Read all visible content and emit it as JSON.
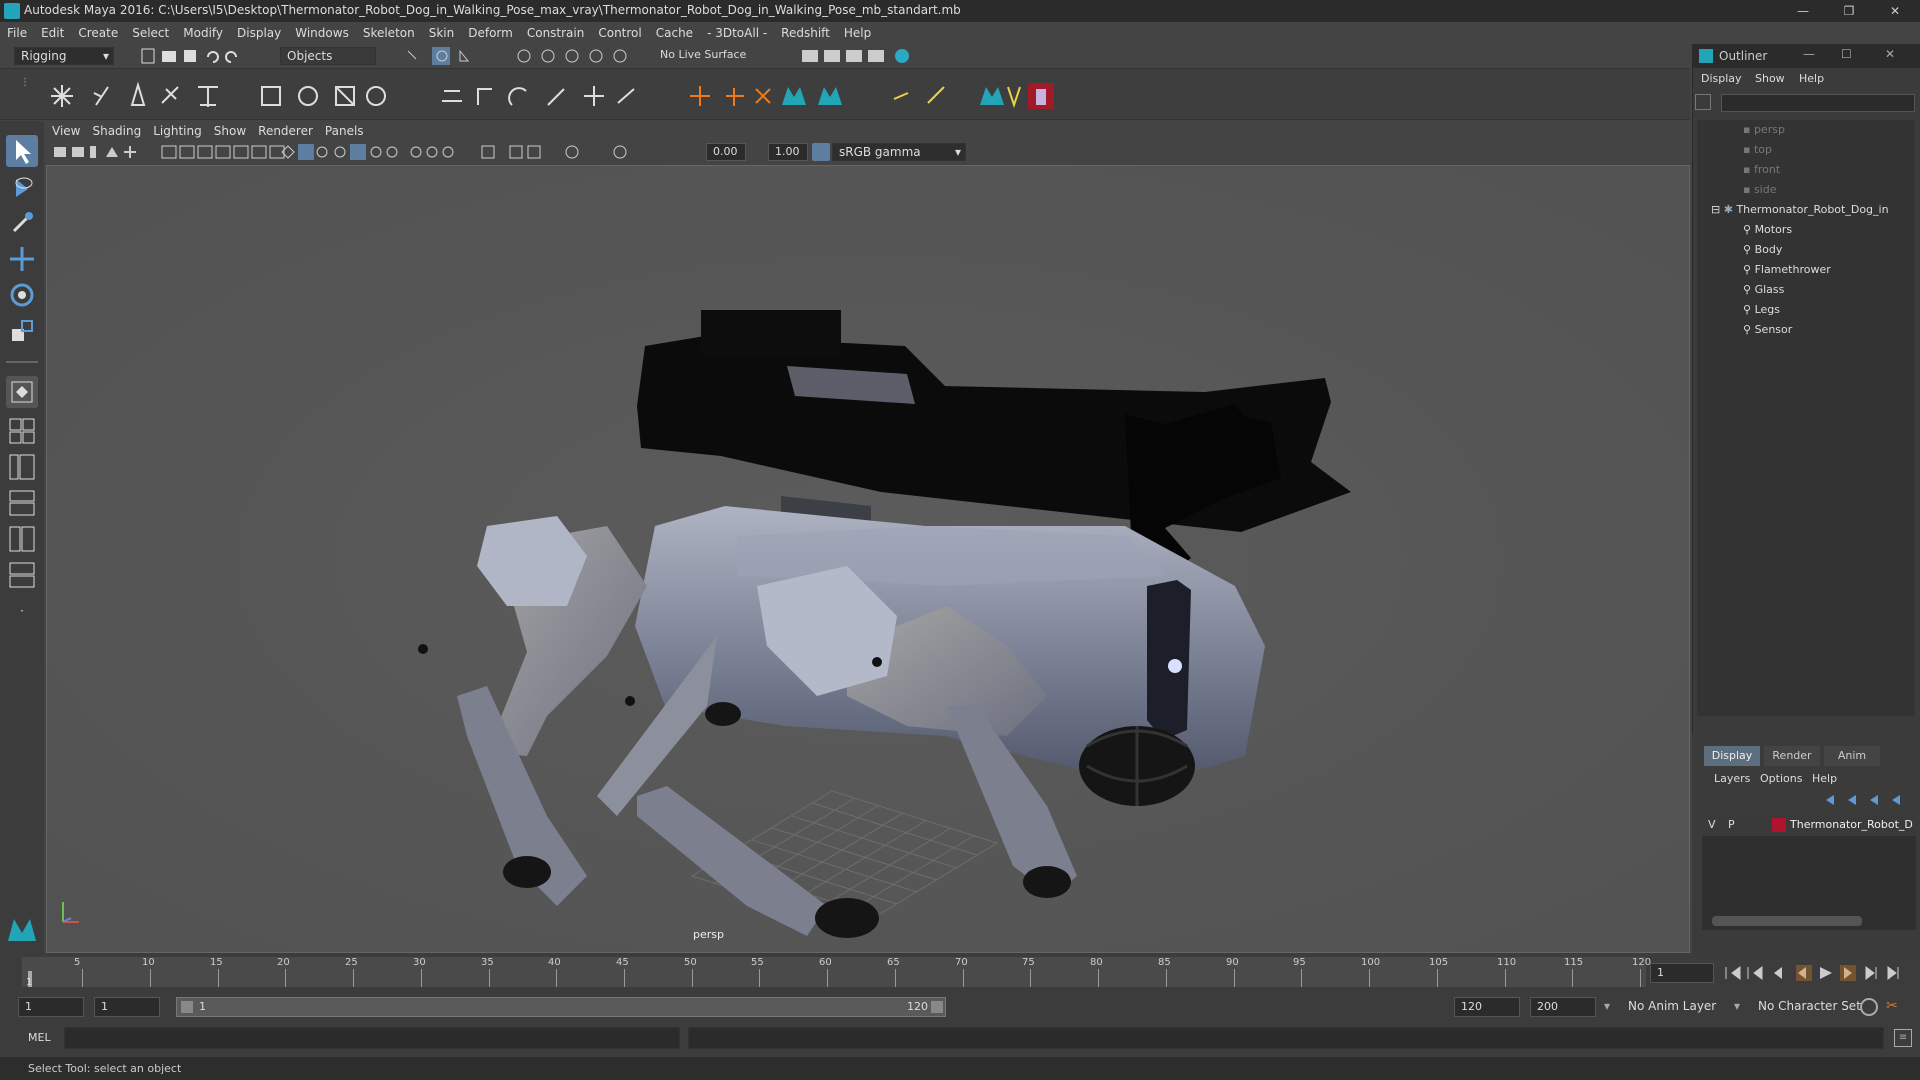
{
  "window": {
    "title": "Autodesk Maya 2016: C:\\Users\\I5\\Desktop\\Thermonator_Robot_Dog_in_Walking_Pose_max_vray\\Thermonator_Robot_Dog_in_Walking_Pose_mb_standart.mb",
    "minimize": "—",
    "maximize": "❐",
    "close": "✕"
  },
  "menubar": [
    "File",
    "Edit",
    "Create",
    "Select",
    "Modify",
    "Display",
    "Windows",
    "Skeleton",
    "Skin",
    "Deform",
    "Constrain",
    "Control",
    "Cache",
    "- 3DtoAll -",
    "Redshift",
    "Help"
  ],
  "statusline": {
    "mode": "Rigging",
    "selection_mask": "Objects",
    "live_surface": "No Live Surface"
  },
  "panel": {
    "menus": [
      "View",
      "Shading",
      "Lighting",
      "Show",
      "Renderer",
      "Panels"
    ],
    "exposure": "0.00",
    "gamma": "1.00",
    "color_space": "sRGB gamma"
  },
  "viewport": {
    "camera_label": "persp"
  },
  "outliner": {
    "title": "Outliner",
    "menus": [
      "Display",
      "Show",
      "Help"
    ],
    "cameras": [
      "persp",
      "top",
      "front",
      "side"
    ],
    "root": "Thermonator_Robot_Dog_in",
    "children": [
      "Motors",
      "Body",
      "Flamethrower",
      "Glass",
      "Legs",
      "Sensor"
    ]
  },
  "layer_editor": {
    "tabs": [
      "Display",
      "Render",
      "Anim"
    ],
    "menus": [
      "Layers",
      "Options",
      "Help"
    ],
    "layer": {
      "v": "V",
      "p": "P",
      "name": "Thermonator_Robot_D",
      "color": "#b0142c"
    }
  },
  "timeline": {
    "ticks": [
      "5",
      "10",
      "15",
      "20",
      "25",
      "30",
      "35",
      "40",
      "45",
      "50",
      "55",
      "60",
      "65",
      "70",
      "75",
      "80",
      "85",
      "90",
      "95",
      "100",
      "105",
      "110",
      "115",
      "120"
    ],
    "current_frame_marker": "1",
    "current_frame": "1"
  },
  "range": {
    "start": "1",
    "playback_start": "1",
    "slider_start": "1",
    "slider_end": "120",
    "playback_end": "120",
    "end": "200",
    "anim_layer": "No Anim Layer",
    "character_set": "No Character Set"
  },
  "cmdline": {
    "label": "MEL"
  },
  "helpline": {
    "text": "Select Tool: select an object"
  },
  "colors": {
    "accent": "#5d9bd6",
    "maya_teal": "#23a5b8",
    "layer_red": "#b0142c"
  }
}
